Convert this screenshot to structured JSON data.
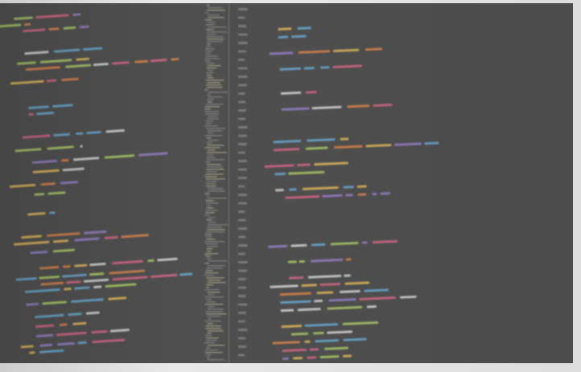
{
  "image": {
    "subject": "photo",
    "palette": {
      "background": "#505050",
      "edge": "#e9e9e9",
      "divider": "#6a6a6a",
      "gutter_text": "#8c8c8c",
      "code_colors": [
        "#6db3e0",
        "#f2c35b",
        "#e6e6e6",
        "#b5d86a",
        "#e46a8b",
        "#9e86d6",
        "#e98a4a"
      ]
    }
  }
}
